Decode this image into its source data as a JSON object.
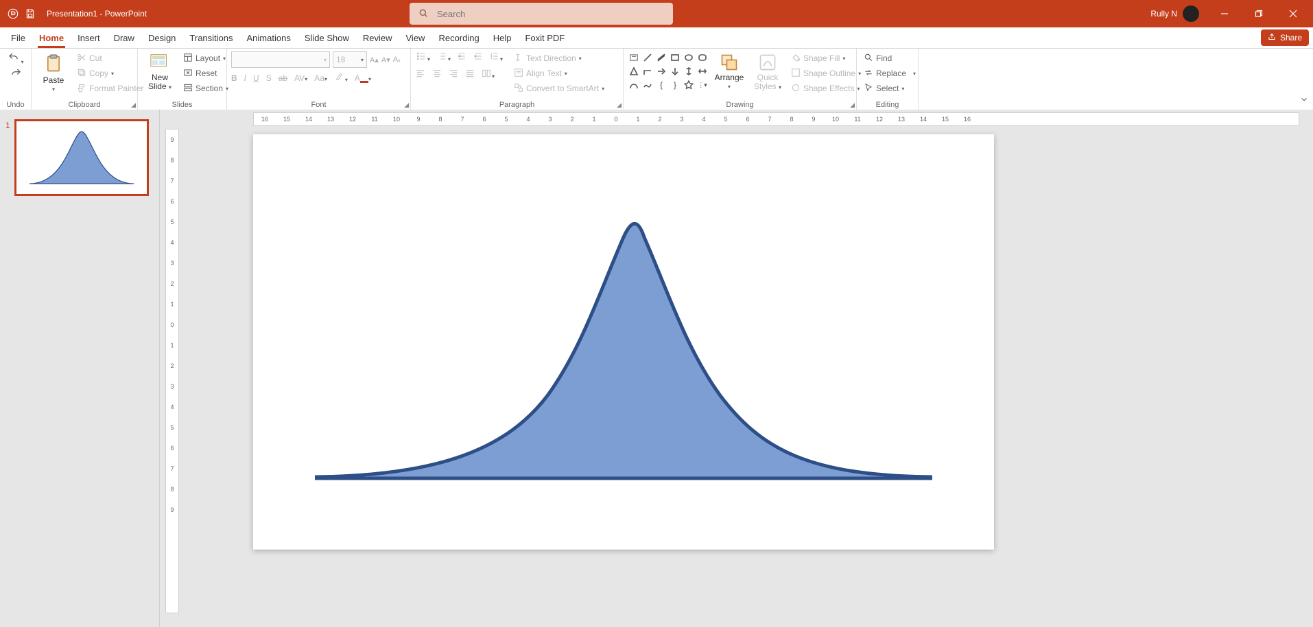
{
  "titlebar": {
    "filename": "Presentation1",
    "app_suffix": "  -  PowerPoint",
    "search_placeholder": "Search",
    "username": "Rully N"
  },
  "tabs": {
    "items": [
      "File",
      "Home",
      "Insert",
      "Draw",
      "Design",
      "Transitions",
      "Animations",
      "Slide Show",
      "Review",
      "View",
      "Recording",
      "Help",
      "Foxit PDF"
    ],
    "active_index": 1,
    "share_label": "Share"
  },
  "ribbon": {
    "undo": {
      "label": "Undo"
    },
    "clipboard": {
      "group_label": "Clipboard",
      "paste": "Paste",
      "cut": "Cut",
      "copy": "Copy",
      "format_painter": "Format Painter"
    },
    "slides": {
      "group_label": "Slides",
      "new_slide_line1": "New",
      "new_slide_line2": "Slide",
      "layout": "Layout",
      "reset": "Reset",
      "section": "Section"
    },
    "font": {
      "group_label": "Font",
      "size_value": "18"
    },
    "paragraph": {
      "group_label": "Paragraph",
      "text_direction": "Text Direction",
      "align_text": "Align Text",
      "convert": "Convert to SmartArt"
    },
    "drawing": {
      "group_label": "Drawing",
      "arrange": "Arrange",
      "quick_styles_line1": "Quick",
      "quick_styles_line2": "Styles",
      "shape_fill": "Shape Fill",
      "shape_outline": "Shape Outline",
      "shape_effects": "Shape Effects"
    },
    "editing": {
      "group_label": "Editing",
      "find": "Find",
      "replace": "Replace",
      "select": "Select"
    }
  },
  "thumbnails": {
    "slides": [
      {
        "number": "1"
      }
    ]
  },
  "ruler": {
    "h": [
      "16",
      "15",
      "14",
      "13",
      "12",
      "11",
      "10",
      "9",
      "8",
      "7",
      "6",
      "5",
      "4",
      "3",
      "2",
      "1",
      "0",
      "1",
      "2",
      "3",
      "4",
      "5",
      "6",
      "7",
      "8",
      "9",
      "10",
      "11",
      "12",
      "13",
      "14",
      "15",
      "16"
    ],
    "v": [
      "9",
      "8",
      "7",
      "6",
      "5",
      "4",
      "3",
      "2",
      "1",
      "0",
      "1",
      "2",
      "3",
      "4",
      "5",
      "6",
      "7",
      "8",
      "9"
    ]
  },
  "chart_data": {
    "type": "area",
    "note": "Bell-curve shape drawn on slide (no axes/labels; shape only)",
    "x": [
      -7,
      -6,
      -5,
      -4,
      -3,
      -2,
      -1,
      0,
      1,
      2,
      3,
      4,
      5,
      6,
      7
    ],
    "y": [
      0.01,
      0.015,
      0.025,
      0.05,
      0.13,
      0.35,
      0.78,
      1.0,
      0.78,
      0.35,
      0.13,
      0.05,
      0.025,
      0.015,
      0.01
    ],
    "ylim": [
      0,
      1
    ],
    "fill_color": "#7c9ed3",
    "stroke_color": "#2d4e86"
  }
}
